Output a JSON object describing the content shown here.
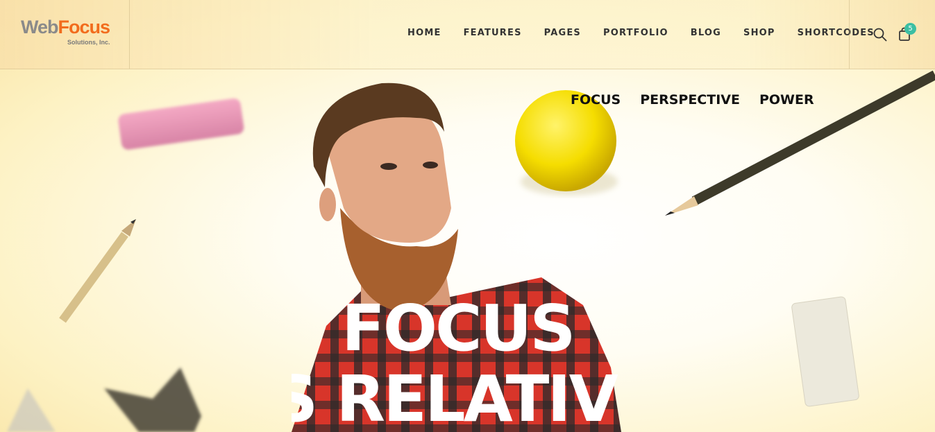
{
  "brand": {
    "logo_web": "Web",
    "logo_focus": "Focus",
    "logo_sub": "Solutions, Inc."
  },
  "nav": {
    "items": [
      "HOME",
      "FEATURES",
      "PAGES",
      "PORTFOLIO",
      "BLOG",
      "SHOP",
      "SHORTCODES"
    ]
  },
  "cart": {
    "count": "5"
  },
  "hero": {
    "tabs": [
      "FOCUS",
      "PERSPECTIVE",
      "POWER"
    ],
    "line1": "FOCUS",
    "line2": "S RELATIV"
  },
  "colors": {
    "accent": "#f26c1d",
    "badge": "#3cbfa3"
  }
}
